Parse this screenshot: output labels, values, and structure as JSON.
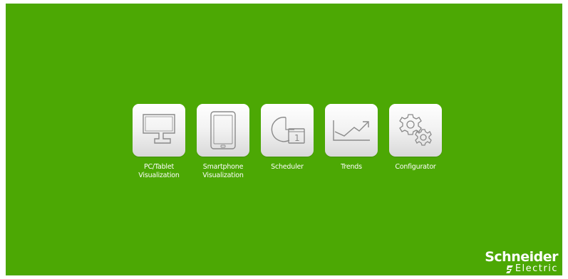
{
  "apps": [
    {
      "icon": "monitor-icon",
      "label_lines": [
        "PC/Tablet",
        "Visualization"
      ]
    },
    {
      "icon": "tablet-icon",
      "label_lines": [
        "Smartphone",
        "Visualization"
      ]
    },
    {
      "icon": "scheduler-icon",
      "label_lines": [
        "Scheduler"
      ]
    },
    {
      "icon": "trends-icon",
      "label_lines": [
        "Trends"
      ]
    },
    {
      "icon": "gears-icon",
      "label_lines": [
        "Configurator"
      ]
    }
  ],
  "scheduler_day": "1",
  "logo": {
    "name": "Schneider",
    "subtitle": "Electric"
  },
  "colors": {
    "background": "#4ca804",
    "icon_stroke": "#8a8a8a",
    "text": "#ffffff"
  }
}
